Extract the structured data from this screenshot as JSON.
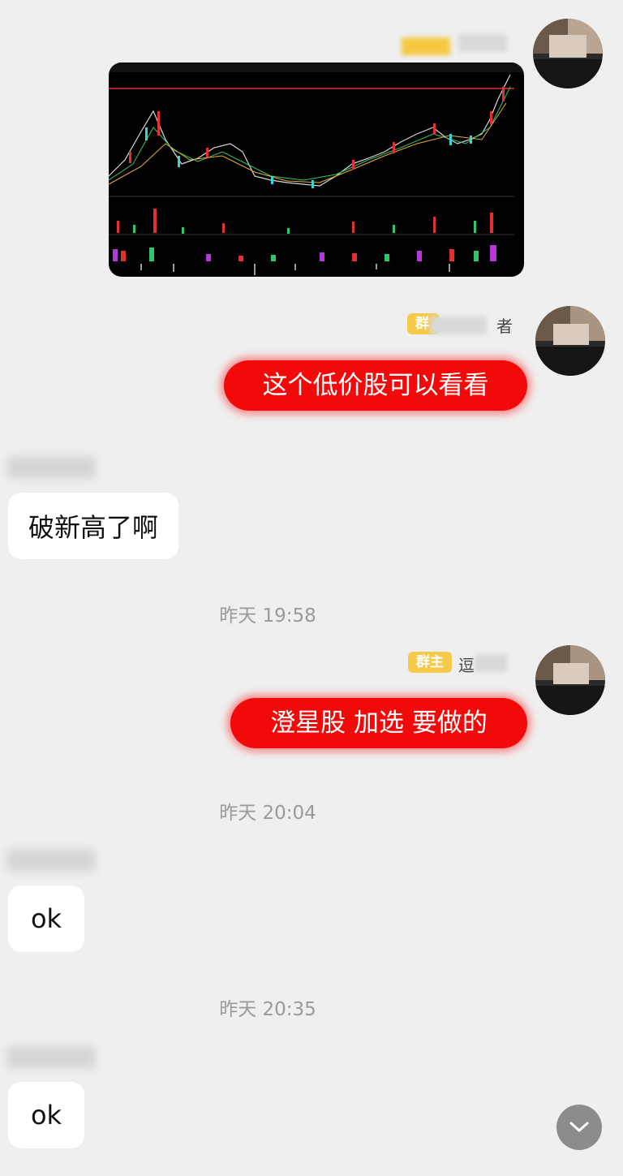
{
  "messages": {
    "m2": {
      "badge": "群",
      "sender_suffix": "者",
      "text": "这个低价股可以看看"
    },
    "m3": {
      "text": "破新高了啊"
    },
    "t1": "昨天 19:58",
    "m4": {
      "badge": "群主",
      "sender_prefix": "逗",
      "text": "澄星股 加选  要做的"
    },
    "t2": "昨天 20:04",
    "m5": {
      "text": "ok"
    },
    "t3": "昨天 20:35",
    "m6": {
      "text": "ok"
    }
  },
  "colors": {
    "background": "#efefef",
    "red_bubble": "#f20a0a",
    "badge": "#f7c948",
    "chart_bg": "#000000"
  },
  "icons": {
    "scroll_down": "chevron-down-icon"
  }
}
